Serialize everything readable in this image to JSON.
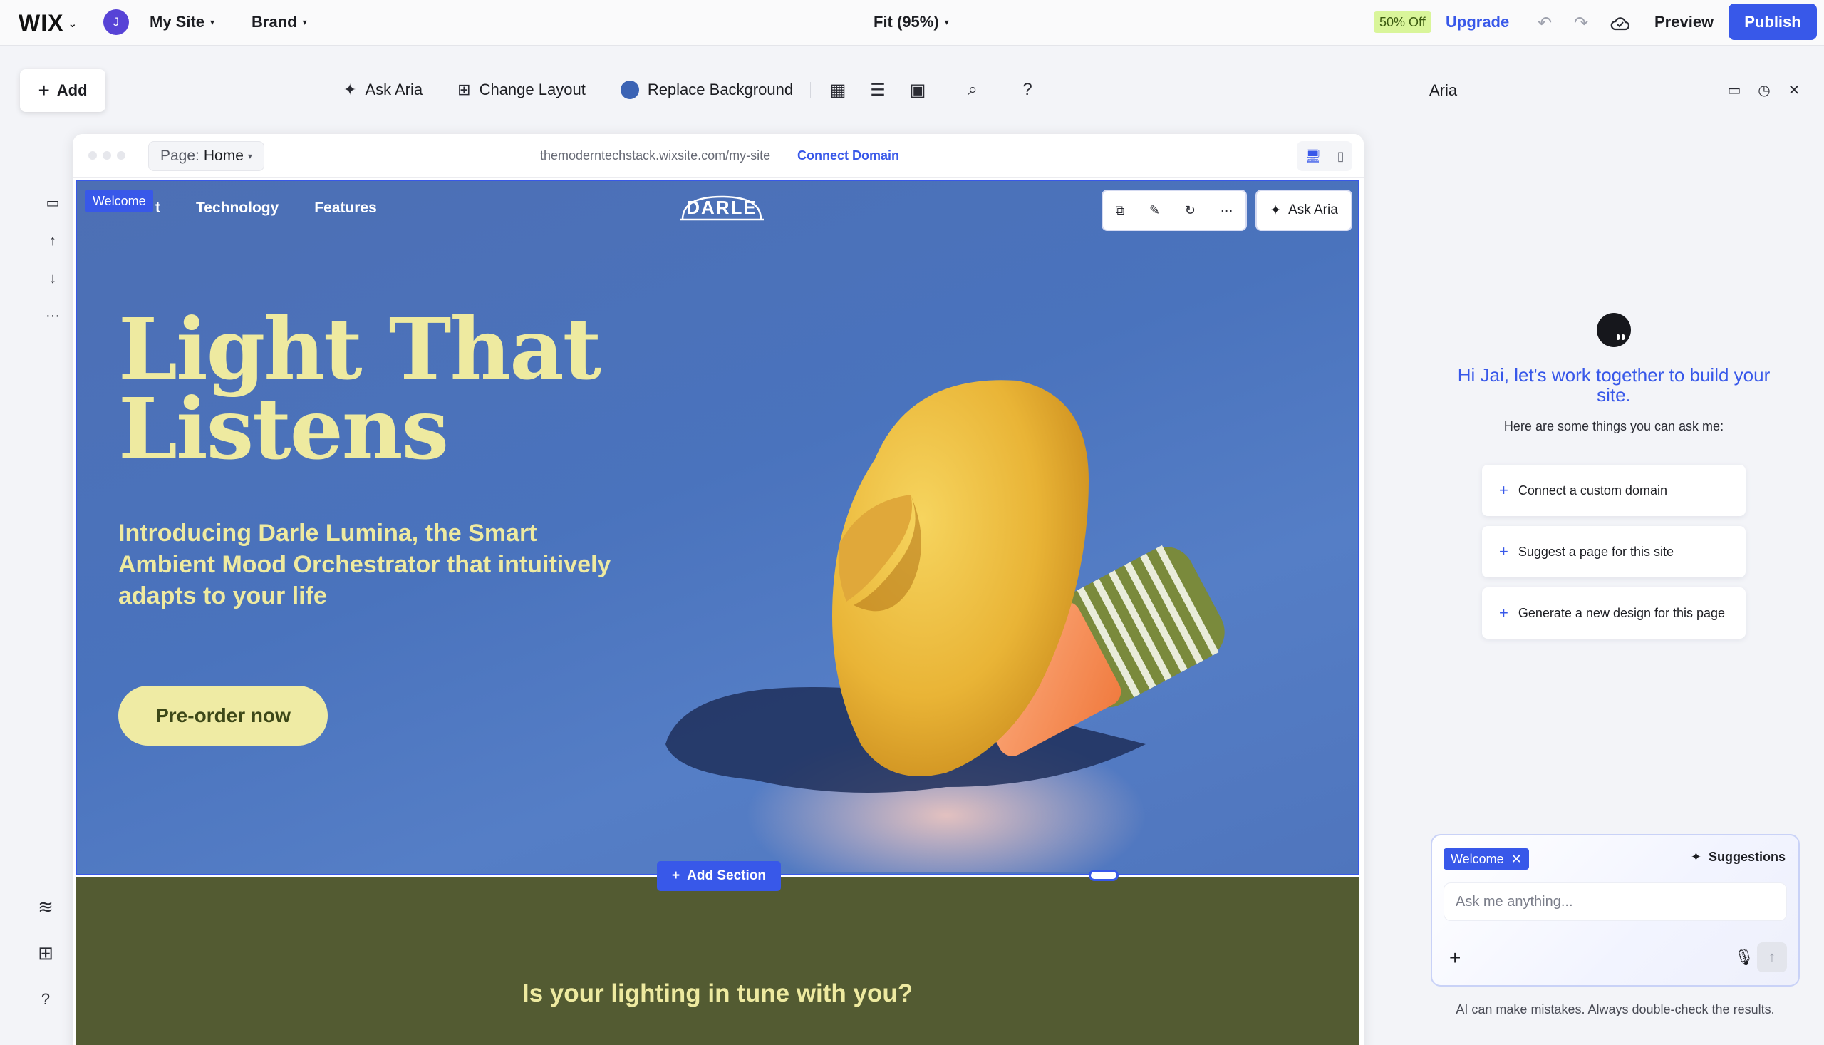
{
  "topbar": {
    "logo": "WIX",
    "user_initial": "J",
    "site_menu": "My Site",
    "brand_menu": "Brand",
    "zoom": "Fit (95%)",
    "discount_badge": "50% Off",
    "upgrade": "Upgrade",
    "preview": "Preview",
    "publish": "Publish"
  },
  "toolbar": {
    "add": "Add",
    "ask_aria": "Ask Aria",
    "change_layout": "Change Layout",
    "replace_background": "Replace Background",
    "help": "?"
  },
  "left_rail": {
    "help": "?"
  },
  "frame": {
    "page_label": "Page:",
    "page_name": "Home",
    "url": "themoderntechstack.wixsite.com/my-site",
    "connect_domain": "Connect Domain"
  },
  "site": {
    "section_tag": "Welcome",
    "nav": [
      "About",
      "Technology",
      "Features"
    ],
    "nav_first_visible": "t",
    "logo": "DARLE",
    "float_ask_aria": "Ask Aria",
    "hero_title_line1": "Light That",
    "hero_title_line2": "Listens",
    "hero_subtitle": "Introducing Darle Lumina, the Smart Ambient Mood Orchestrator that intuitively adapts to your life",
    "cta": "Pre-order now",
    "add_section": "Add Section",
    "next_section_title": "Is your lighting in tune with you?"
  },
  "aria": {
    "title": "Aria",
    "greeting": "Hi Jai, let's work together to build your site.",
    "hint": "Here are some things you can ask me:",
    "suggestions": [
      "Connect a custom domain",
      "Suggest a page for this site",
      "Generate a new design for this page"
    ],
    "chat_tag": "Welcome",
    "suggestions_button": "Suggestions",
    "input_placeholder": "Ask me anything...",
    "disclaimer": "AI can make mistakes. Always double-check the results."
  },
  "colors": {
    "accent": "#3858e9",
    "hero_bg": "#4a73bd",
    "hero_text": "#eeeaa0",
    "olive_bg": "#535b32",
    "cta_bg": "#efeba4"
  }
}
